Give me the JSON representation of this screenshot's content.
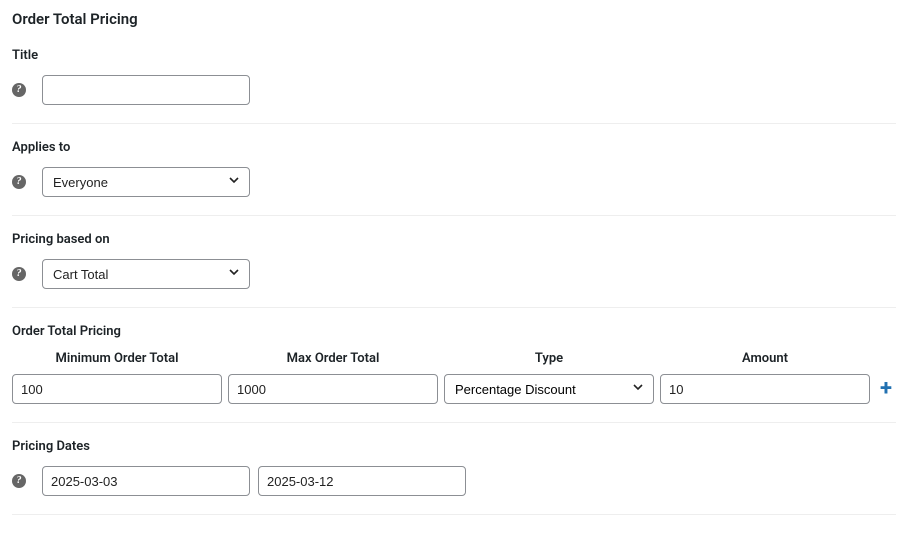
{
  "page": {
    "title": "Order Total Pricing"
  },
  "title_field": {
    "label": "Title",
    "value": ""
  },
  "applies_to": {
    "label": "Applies to",
    "value": "Everyone"
  },
  "pricing_based_on": {
    "label": "Pricing based on",
    "value": "Cart Total"
  },
  "table": {
    "heading": "Order Total Pricing",
    "columns": {
      "min": "Minimum Order Total",
      "max": "Max Order Total",
      "type": "Type",
      "amount": "Amount"
    },
    "row": {
      "min": "100",
      "max": "1000",
      "type": "Percentage Discount",
      "amount": "10"
    }
  },
  "dates": {
    "label": "Pricing Dates",
    "from": "2025-03-03",
    "to": "2025-03-12"
  }
}
